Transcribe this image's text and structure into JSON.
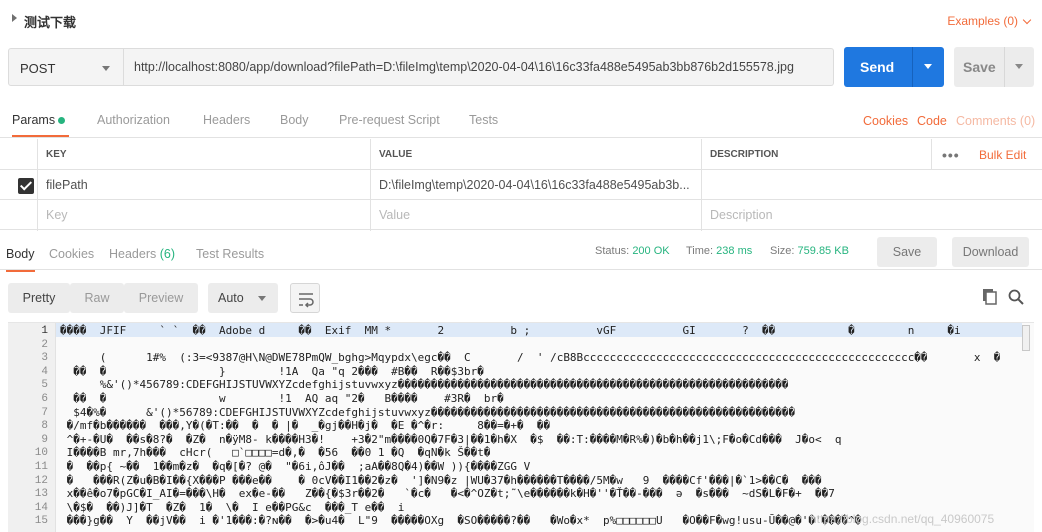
{
  "title": "测试下载",
  "examples_label": "Examples (0)",
  "request": {
    "method": "POST",
    "url": "http://localhost:8080/app/download?filePath=D:\\fileImg\\temp\\2020-04-04\\16\\16c33fa488e5495ab3bb876b2d155578.jpg",
    "send_label": "Send",
    "save_label": "Save"
  },
  "request_tabs": [
    "Params",
    "Authorization",
    "Headers",
    "Body",
    "Pre-request Script",
    "Tests"
  ],
  "request_links": {
    "cookies": "Cookies",
    "code": "Code",
    "comments": "Comments (0)"
  },
  "params_table": {
    "headers": [
      "KEY",
      "VALUE",
      "DESCRIPTION"
    ],
    "more_icon": "•••",
    "bulk_edit": "Bulk Edit",
    "rows": [
      {
        "checked": true,
        "key": "filePath",
        "value": "D:\\fileImg\\temp\\2020-04-04\\16\\16c33fa488e5495ab3b...",
        "description": ""
      }
    ],
    "placeholders": {
      "key": "Key",
      "value": "Value",
      "description": "Description"
    }
  },
  "response_tabs": [
    {
      "label": "Body"
    },
    {
      "label": "Cookies"
    },
    {
      "label": "Headers",
      "count": "(6)"
    },
    {
      "label": "Test Results"
    }
  ],
  "response_status": {
    "status_label": "Status:",
    "status_value": "200 OK",
    "time_label": "Time:",
    "time_value": "238 ms",
    "size_label": "Size:",
    "size_value": "759.85 KB"
  },
  "response_buttons": {
    "save": "Save",
    "download": "Download"
  },
  "view_modes": [
    "Pretty",
    "Raw",
    "Preview"
  ],
  "format_select": "Auto",
  "icons": {
    "copy": "copy-icon",
    "search": "search-icon",
    "wrap": "wrap-lines-icon"
  },
  "body_lines": [
    "����  JFIF     ` `  ��  Adobe d     ��  Exif  MM *       2          b ;          vGF          GI       ?  ��           �        n     �i",
    "",
    "      (      1#%  (:3=<9387@H\\N@DWE78PmQW_bghg>Mqypdx\\egc��  C       /  ' /cB8Bcccccccccccccccccccccccccccccccccccccccccccccccccc��       x  �   \"",
    "  ��  �                 }        !1A  Qa \"q 2���  #B��  R��$3br�",
    "      %&'()*456789:CDEFGHIJSTUVWXYZcdefghijstuvwxyz�����������������������������������������������������������",
    "  ��  �                 w        !1  AQ aq \"2�   B����    #3R�  br�",
    "  $4�%�      &'()*56789:CDEFGHIJSTUVWXYZcdefghijstuvwxyz�������������������������������������������������������",
    " �/mf�b������  ���,Y�(�T:��  �  � |�  _�gj��H�j�  �E �^�r:     8��=�+�  ��",
    " ^�+-�U�  ��s�8?�  �Z�  n�ÿM8- k����H3�!    +3�2\"m����0Q�7F�3|��1�h�X  �$  ��:T:����M�R%�)�b�h��j1\\;F�o�Cd���  J�o<  q",
    " I����B mr,7h���  cHcr(   □`□□□□=d�,�  �56  ��0 1 �Q  �qN�k Š��t�",
    " �  ��p{ ~��  1��m�z�  �q�[�? @�  \"�6i,ôJ��  ;aA��8Q�4)��W )){����ZGG V",
    " �   ���R(Z�u�B�I��{X���P ���e��    � 0cV��I1��2�z�  ']�N9�z |WU�37�h������T����/5M�w   9  ����Cf'���|�`1>��C�  ���",
    " x��ê�o7�pGC�I_AI�=���\\H�  ex�e-��   Z��{�$3r��2�   `�c�   �<�^OZ�t;̃ \\e������k�H�''�Ť��-���  ǝ  �s���  ~dS�L�F�+  ��7",
    " \\�$�  ��)J]�T  �Z�  1�  \\�  I e��PG&c  ���_T e��  i",
    " ���}g��  Y  ��jV��  i �'1���:�?ɴ��  �>�u4�  L\"9  �����OXg  �SO�����?��   �Wo�x*  p%□□□□□□U   �O��F�wg!usu-Ū��@�'�'����^�"
  ],
  "watermark": "https://blog.csdn.net/qq_40960075"
}
